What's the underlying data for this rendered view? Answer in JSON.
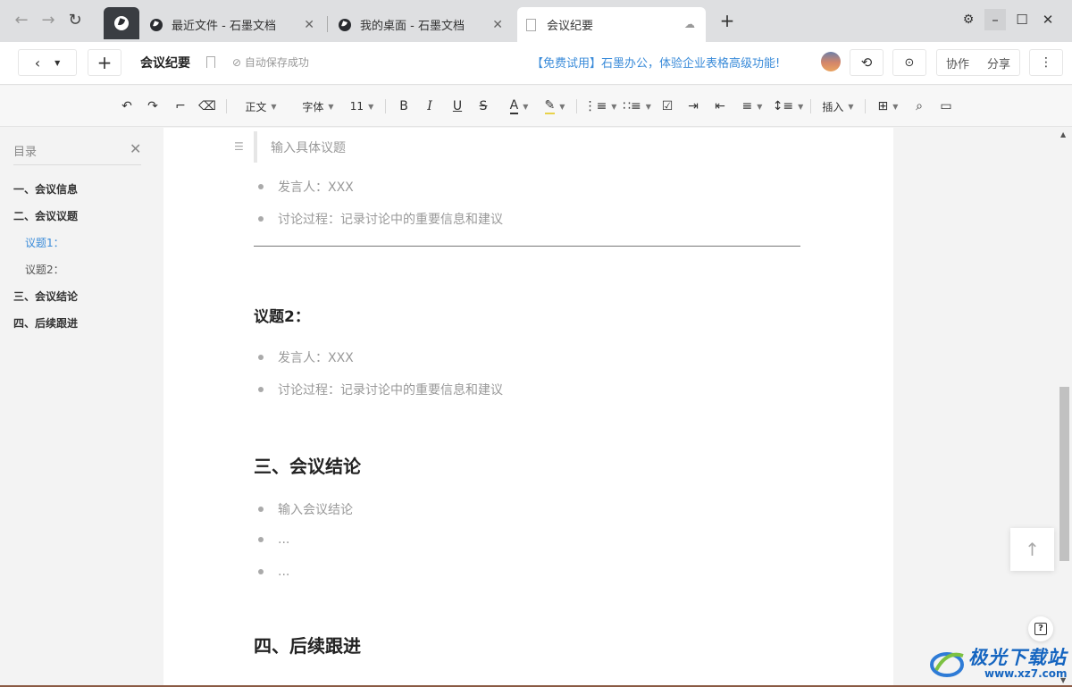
{
  "tabs": {
    "items": [
      {
        "label": "最近文件 - 石墨文档"
      },
      {
        "label": "我的桌面 - 石墨文档"
      },
      {
        "label": "会议纪要"
      }
    ],
    "close": "✕",
    "new_tab": "+"
  },
  "header": {
    "title": "会议纪要",
    "save_status": "自动保存成功",
    "promo": "【免费试用】石墨办公，体验企业表格高级功能!",
    "collab_label": "协作",
    "share_label": "分享",
    "more": "⋮"
  },
  "toolbar": {
    "style_label": "正文",
    "font_label": "字体",
    "size_label": "11",
    "bold": "B",
    "italic": "I",
    "underline": "U",
    "strike": "S",
    "text_color": "A",
    "insert_label": "插入"
  },
  "sidebar": {
    "title": "目录",
    "items": [
      {
        "label": "一、会议信息",
        "level": 1
      },
      {
        "label": "二、会议议题",
        "level": 1
      },
      {
        "label": "议题1：",
        "level": 2,
        "active": true
      },
      {
        "label": "议题2：",
        "level": 2
      },
      {
        "label": "三、会议结论",
        "level": 1
      },
      {
        "label": "四、后续跟进",
        "level": 1
      }
    ]
  },
  "document": {
    "placeholder_topic": "输入具体议题",
    "topic1_bullets": [
      "发言人：XXX",
      "讨论过程：记录讨论中的重要信息和建议"
    ],
    "topic2_heading": "议题2：",
    "topic2_bullets": [
      "发言人：XXX",
      "讨论过程：记录讨论中的重要信息和建议"
    ],
    "conclusion_heading": "三、会议结论",
    "conclusion_bullets": [
      "输入会议结论",
      "...",
      "..."
    ],
    "followup_heading": "四、后续跟进"
  },
  "watermark": {
    "text": "极光下载站",
    "url": "www.xz7.com"
  },
  "colors": {
    "accent": "#3a8bd9",
    "dark_tab": "#3a3d42",
    "watermark": "#1565c0"
  }
}
